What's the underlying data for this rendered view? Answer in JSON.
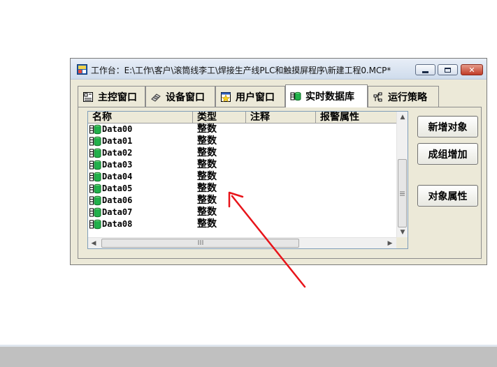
{
  "window": {
    "title": "工作台：E:\\工作\\客户\\滚筒线李工\\焊接生产线PLC和触摸屏程序\\新建工程0.MCP*",
    "minimize_icon": "minimize-icon",
    "maximize_icon": "maximize-icon",
    "close_icon": "close-icon"
  },
  "tabs": [
    {
      "label": "主控窗口",
      "icon": "main-window-icon",
      "active": false
    },
    {
      "label": "设备窗口",
      "icon": "device-window-icon",
      "active": false
    },
    {
      "label": "用户窗口",
      "icon": "user-window-icon",
      "active": false
    },
    {
      "label": "实时数据库",
      "icon": "realtime-database-icon",
      "active": true
    },
    {
      "label": "运行策略",
      "icon": "run-strategy-icon",
      "active": false
    }
  ],
  "list": {
    "columns": [
      "名称",
      "类型",
      "注释",
      "报警属性"
    ],
    "rows": [
      {
        "name": "Data00",
        "type": "整数"
      },
      {
        "name": "Data01",
        "type": "整数"
      },
      {
        "name": "Data02",
        "type": "整数"
      },
      {
        "name": "Data03",
        "type": "整数"
      },
      {
        "name": "Data04",
        "type": "整数"
      },
      {
        "name": "Data05",
        "type": "整数"
      },
      {
        "name": "Data06",
        "type": "整数"
      },
      {
        "name": "Data07",
        "type": "整数"
      },
      {
        "name": "Data08",
        "type": "整数"
      }
    ]
  },
  "buttons": {
    "new_object": "新增对象",
    "group_add": "成组增加",
    "object_properties": "对象属性"
  },
  "colors": {
    "annotation_arrow": "#e8141a",
    "db_icon_green": "#22b14c"
  }
}
